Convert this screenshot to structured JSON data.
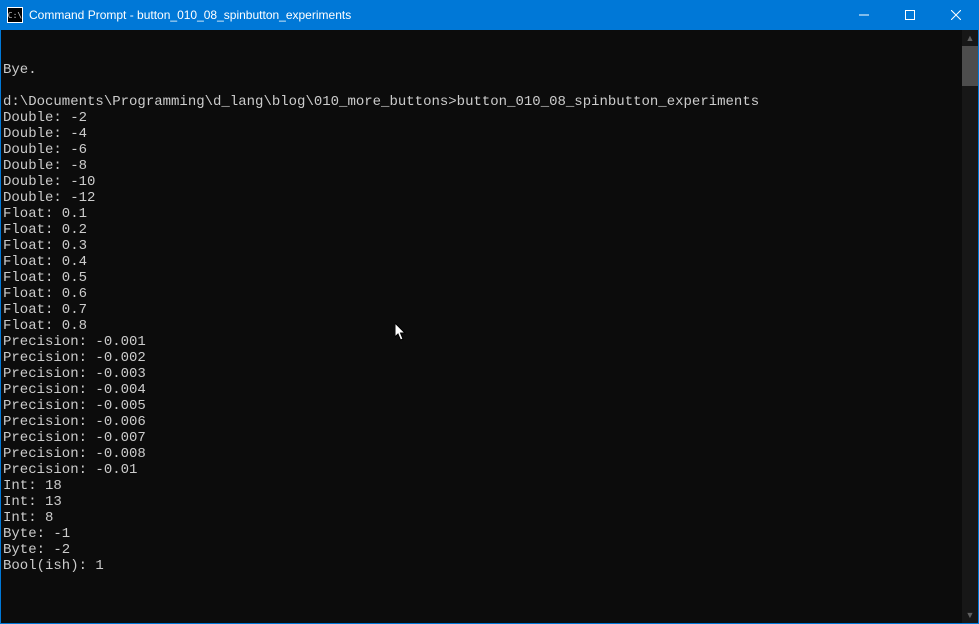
{
  "titlebar": {
    "icon_label": "C:\\",
    "title": "Command Prompt - button_010_08_spinbutton_experiments",
    "minimize": "—",
    "maximize": "□",
    "close": "✕"
  },
  "terminal": {
    "lines": [
      "Bye.",
      "",
      "d:\\Documents\\Programming\\d_lang\\blog\\010_more_buttons>button_010_08_spinbutton_experiments",
      "Double: -2",
      "Double: -4",
      "Double: -6",
      "Double: -8",
      "Double: -10",
      "Double: -12",
      "Float: 0.1",
      "Float: 0.2",
      "Float: 0.3",
      "Float: 0.4",
      "Float: 0.5",
      "Float: 0.6",
      "Float: 0.7",
      "Float: 0.8",
      "Precision: -0.001",
      "Precision: -0.002",
      "Precision: -0.003",
      "Precision: -0.004",
      "Precision: -0.005",
      "Precision: -0.006",
      "Precision: -0.007",
      "Precision: -0.008",
      "Precision: -0.01",
      "Int: 18",
      "Int: 13",
      "Int: 8",
      "Byte: -1",
      "Byte: -2",
      "Bool(ish): 1"
    ]
  },
  "scrollbar": {
    "up": "▲",
    "down": "▼"
  }
}
